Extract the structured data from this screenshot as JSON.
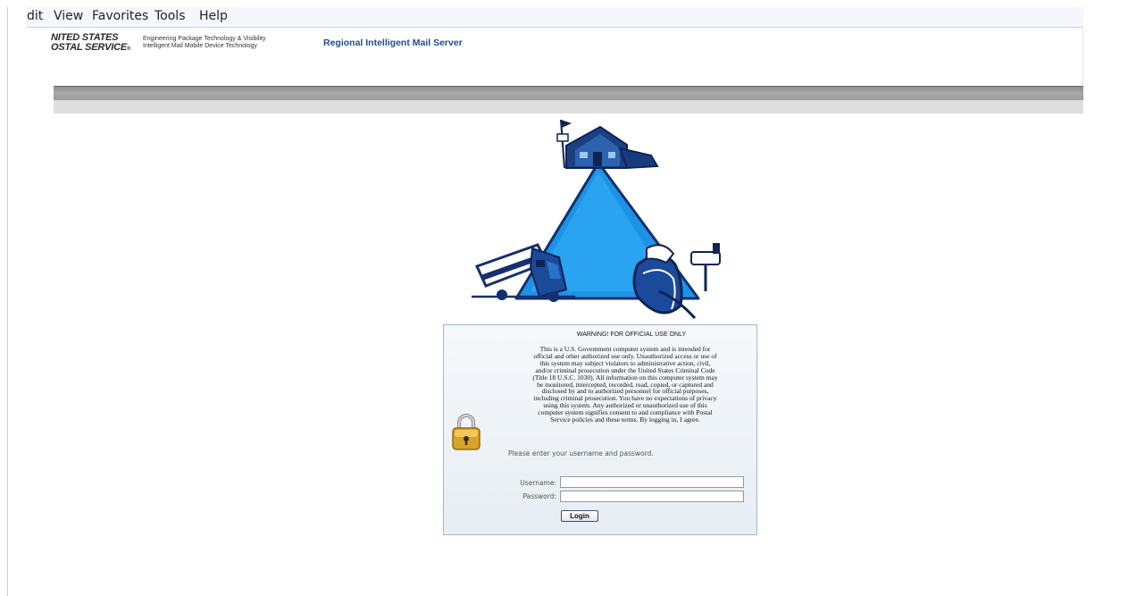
{
  "menu": {
    "items": [
      {
        "label": "dit"
      },
      {
        "label": "View"
      },
      {
        "label": "Favorites"
      },
      {
        "label": "Tools"
      },
      {
        "label": "Help"
      }
    ]
  },
  "header": {
    "brand_line1": "NITED STATES",
    "brand_line2": "OSTAL SERVICE",
    "brand_mark": "®",
    "tagline1": "Engineering Package Technology & Visibility",
    "tagline2": "Intelligent Mail Mobile Device Technology",
    "app_title": "Regional Intelligent Mail Server"
  },
  "illustration": {
    "icon": "mail-delivery-triangle-icon",
    "colors": {
      "triangle": "#1e93e6",
      "outline": "#15306e"
    }
  },
  "login": {
    "lock_icon": "padlock-icon",
    "warning_title": "WARNING! FOR OFFICIAL USE ONLY",
    "warning_lines": [
      "This is a U.S. Government computer system and is intended for",
      "official and other authorized use only. Unauthorized access or use of",
      "this system may subject violators to administrative action, civil,",
      "and/or criminal prosecution under the United States Criminal Code",
      "(Title 18 U.S.C. 1030). All information on this computer system may",
      "be monitored, intercepted, recorded, read, copied, or captured and",
      "disclosed by and to authorized personnel for official purposes,",
      "including criminal prosecution. You have no expectations of privacy",
      "using this system. Any authorized or unauthorized use of this",
      "computer system signifies consent to and compliance with Postal",
      "Service policies and these terms. By logging in, I agree."
    ],
    "prompt": "Please enter your username and password.",
    "username_label": "Username:",
    "username_value": "",
    "password_label": "Password:",
    "password_value": "",
    "button_label": "Login"
  },
  "colors": {
    "app_title": "#1d4e8c",
    "panel_bg": "#eef2f6",
    "header_bar": "#9d9d9d",
    "header_bar_light": "#dedede"
  }
}
